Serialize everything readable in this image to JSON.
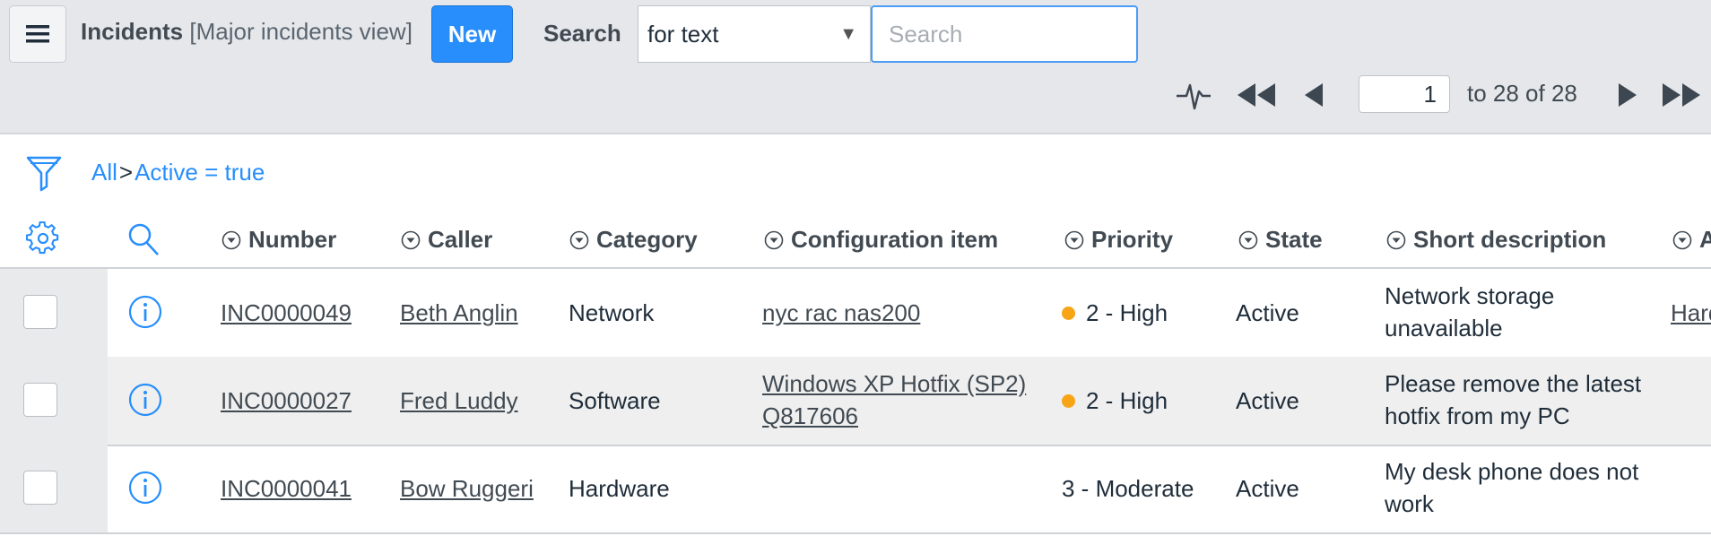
{
  "header": {
    "title": "Incidents",
    "view": "[Major incidents view]",
    "new_label": "New",
    "search_label": "Search",
    "search_field_select": "for text",
    "search_placeholder": "Search"
  },
  "pager": {
    "current_page": "1",
    "range_text": "to 28 of 28"
  },
  "breadcrumb": {
    "all": "All",
    "separator": ">",
    "filter": "Active = true"
  },
  "columns": [
    "Number",
    "Caller",
    "Category",
    "Configuration item",
    "Priority",
    "State",
    "Short description",
    "A"
  ],
  "rows": [
    {
      "number": "INC0000049",
      "caller": "Beth Anglin",
      "category": "Network",
      "ci_line1": "nyc rac nas200",
      "ci_line2": "",
      "priority": "2 - High",
      "priority_dot": true,
      "state": "Active",
      "desc_line1": "Network storage",
      "desc_line2": "unavailable",
      "extra": "Hard"
    },
    {
      "number": "INC0000027",
      "caller": "Fred Luddy",
      "category": "Software",
      "ci_line1": "Windows XP Hotfix (SP2)",
      "ci_line2": "Q817606",
      "priority": "2 - High",
      "priority_dot": true,
      "state": "Active",
      "desc_line1": "Please remove the latest",
      "desc_line2": "hotfix from my PC",
      "extra": ""
    },
    {
      "number": "INC0000041",
      "caller": "Bow Ruggeri",
      "category": "Hardware",
      "ci_line1": "",
      "ci_line2": "",
      "priority": "3 - Moderate",
      "priority_dot": false,
      "state": "Active",
      "desc_line1": "My desk phone does not",
      "desc_line2": "work",
      "extra": ""
    }
  ],
  "colors": {
    "accent": "#278efc",
    "priority_high": "#f7a417",
    "header_bg": "#e5e7ea"
  }
}
